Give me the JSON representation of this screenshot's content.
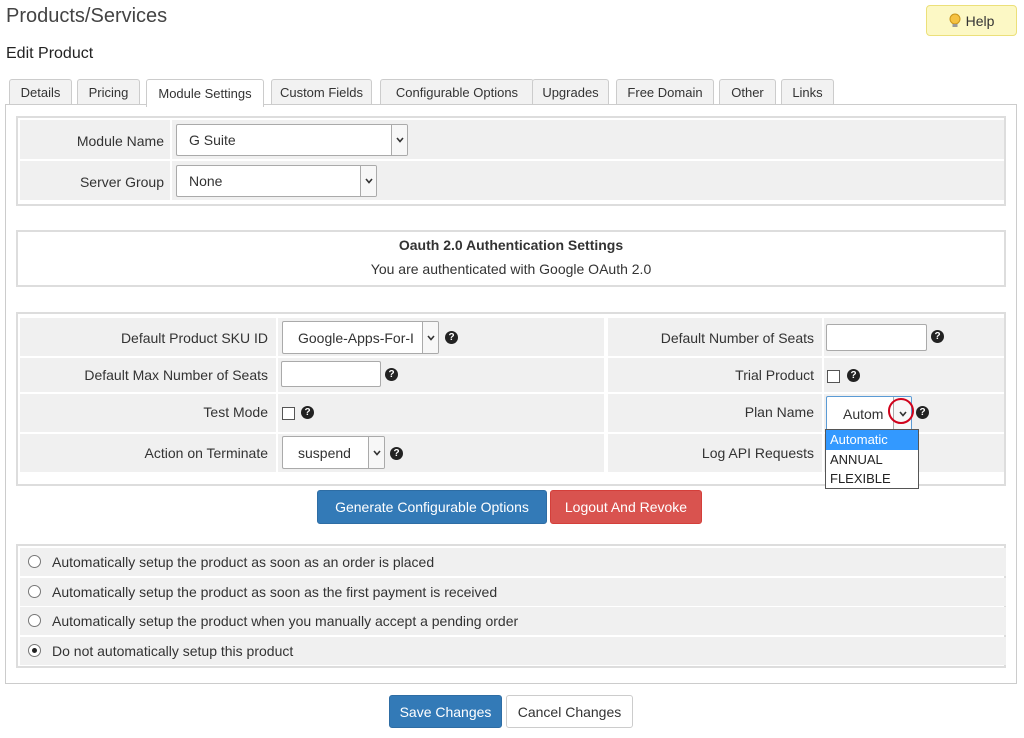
{
  "header": {
    "title": "Products/Services",
    "subtitle": "Edit Product",
    "help_label": "Help"
  },
  "tabs": [
    {
      "label": "Details"
    },
    {
      "label": "Pricing"
    },
    {
      "label": "Module Settings",
      "active": true
    },
    {
      "label": "Custom Fields"
    },
    {
      "label": "Configurable Options"
    },
    {
      "label": "Upgrades"
    },
    {
      "label": "Free Domain"
    },
    {
      "label": "Other"
    },
    {
      "label": "Links"
    }
  ],
  "module": {
    "module_name_label": "Module Name",
    "module_name_value": "G Suite",
    "server_group_label": "Server Group",
    "server_group_value": "None"
  },
  "oauth": {
    "title": "Oauth 2.0 Authentication Settings",
    "status": "You are authenticated with Google OAuth 2.0"
  },
  "settings": {
    "sku_label": "Default Product SKU ID",
    "sku_value": "Google-Apps-For-I",
    "max_seats_label": "Default Max Number of Seats",
    "max_seats_value": "",
    "test_mode_label": "Test Mode",
    "terminate_label": "Action on Terminate",
    "terminate_value": "suspend",
    "num_seats_label": "Default Number of Seats",
    "num_seats_value": "",
    "trial_label": "Trial Product",
    "plan_label": "Plan Name",
    "plan_value": "Autom",
    "log_api_label": "Log API Requests",
    "plan_options": [
      "Automatic",
      "ANNUAL",
      "FLEXIBLE"
    ]
  },
  "actions": {
    "generate_label": "Generate Configurable Options",
    "logout_label": "Logout And Revoke"
  },
  "setup_options": [
    {
      "label": "Automatically setup the product as soon as an order is placed",
      "checked": false
    },
    {
      "label": "Automatically setup the product as soon as the first payment is received",
      "checked": false
    },
    {
      "label": "Automatically setup the product when you manually accept a pending order",
      "checked": false
    },
    {
      "label": "Do not automatically setup this product",
      "checked": true
    }
  ],
  "footer": {
    "save_label": "Save Changes",
    "cancel_label": "Cancel Changes"
  },
  "colors": {
    "primary": "#337ab7",
    "danger": "#d9534f",
    "help_bg": "#fcf8c5",
    "highlight": "#3399ff",
    "annotation": "#d0021b"
  }
}
